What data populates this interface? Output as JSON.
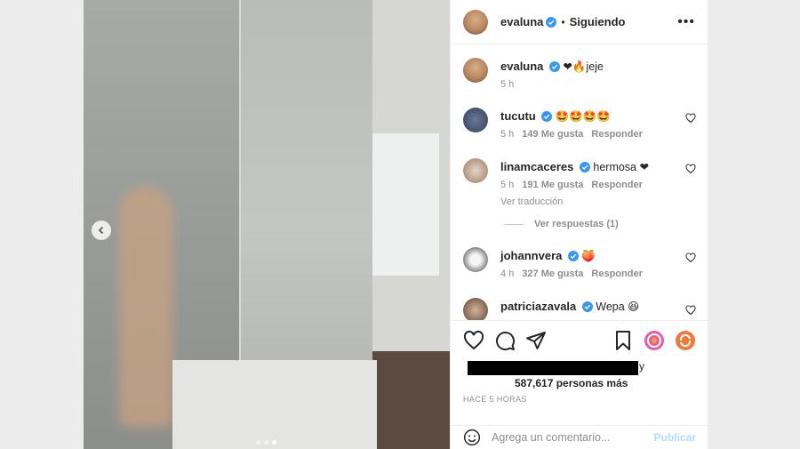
{
  "header": {
    "username": "evaluna",
    "separator": "•",
    "follow_status": "Siguiendo",
    "more_label": "•••"
  },
  "caption": {
    "username": "evaluna",
    "text": "❤🔥jeje",
    "time": "5 h"
  },
  "comments": [
    {
      "username": "tucutu",
      "text": "🤩🤩🤩🤩",
      "time": "5 h",
      "likes": "149 Me gusta",
      "reply": "Responder"
    },
    {
      "username": "linamcaceres",
      "text": "hermosa ❤",
      "time": "5 h",
      "likes": "191 Me gusta",
      "reply": "Responder",
      "translate": "Ver traducción"
    },
    {
      "username": "johannvera",
      "text": "🍑",
      "time": "4 h",
      "likes": "327 Me gusta",
      "reply": "Responder"
    },
    {
      "username": "patriciazavala",
      "text": "Wepa 😆"
    }
  ],
  "view_replies": "Ver respuestas (1)",
  "likes": {
    "trailing": "y",
    "others": "587,617 personas más"
  },
  "timestamp": "HACE 5 HORAS",
  "composer": {
    "placeholder": "Agrega un comentario...",
    "publish": "Publicar"
  },
  "colors": {
    "verified": "#3897f0",
    "heart_red": "#ed4956",
    "publish_disabled": "#b2dffc"
  },
  "carousel": {
    "slides": 3,
    "active": 3
  }
}
